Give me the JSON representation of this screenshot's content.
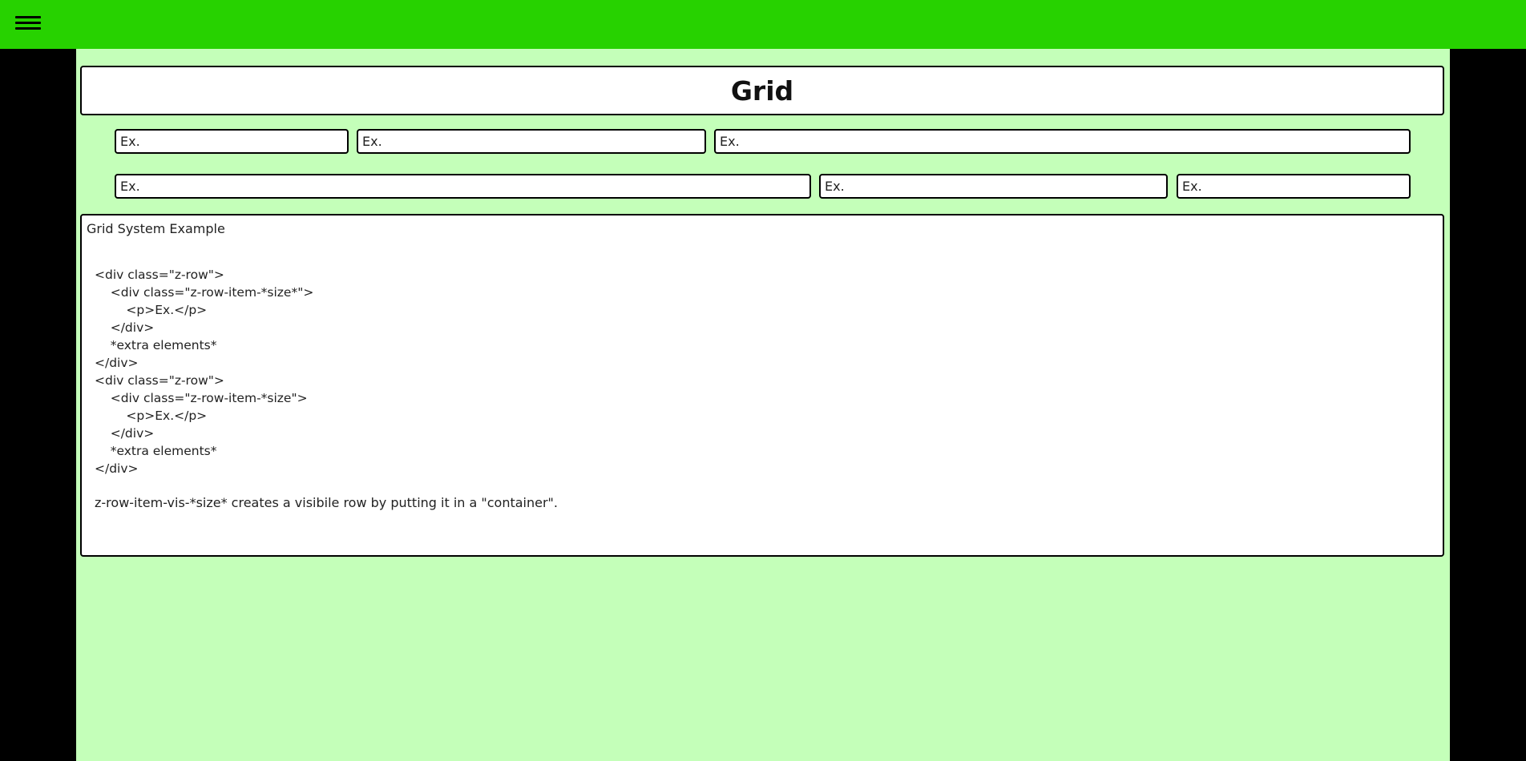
{
  "header": {
    "menu_icon": "hamburger-menu-icon",
    "background": "#27d200"
  },
  "page": {
    "background": "#c4ffb9",
    "title": "Grid"
  },
  "rows": [
    {
      "items": [
        "Ex.",
        "Ex.",
        "Ex."
      ]
    },
    {
      "items": [
        "Ex.",
        "Ex.",
        "Ex."
      ]
    }
  ],
  "example": {
    "title": "Grid System Example",
    "code": "<div class=\"z-row\">\n    <div class=\"z-row-item-*size*\">\n        <p>Ex.</p>\n    </div>\n    *extra elements*\n</div>\n<div class=\"z-row\">\n    <div class=\"z-row-item-*size\">\n        <p>Ex.</p>\n    </div>\n    *extra elements*\n</div>",
    "note": "z-row-item-vis-*size* creates a visibile row by putting it in a \"container\"."
  }
}
